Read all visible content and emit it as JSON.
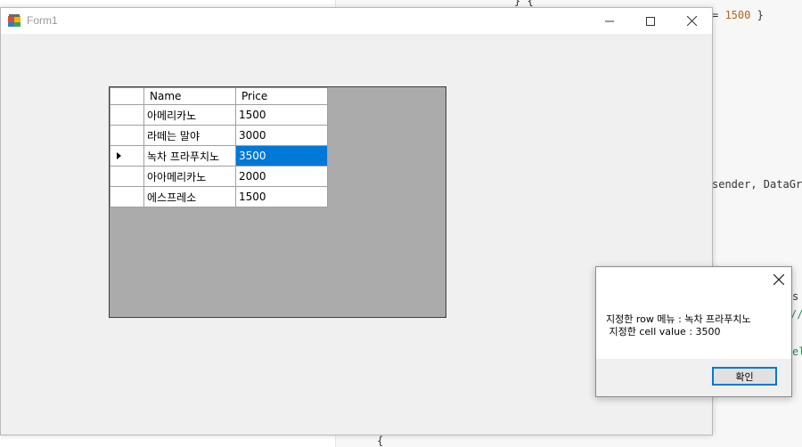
{
  "editor": {
    "lines": [
      {
        "pre": "} { ",
        "num": "",
        "post": ""
      },
      {
        "pre": "= ",
        "num": "1500",
        "post": " }"
      },
      {
        "pre": "sender, DataGri",
        "num": "",
        "post": ""
      },
      {
        "pre": "s",
        "num": "",
        "post": ""
      },
      {
        "pre": "//",
        "num": "",
        "post": ""
      },
      {
        "pre": "el",
        "num": "",
        "post": ""
      },
      {
        "pre": "{",
        "num": "",
        "post": ""
      }
    ]
  },
  "form": {
    "title": "Form1",
    "icons": {
      "app": "form-app-icon",
      "minimize": "minimize-icon",
      "maximize": "maximize-icon",
      "close": "close-icon"
    }
  },
  "grid": {
    "columns": [
      "Name",
      "Price"
    ],
    "rows": [
      {
        "name": "아메리카노",
        "price": "1500"
      },
      {
        "name": "라떼는 말야",
        "price": "3000"
      },
      {
        "name": "녹차 프라푸치노",
        "price": "3500"
      },
      {
        "name": "아아메리카노",
        "price": "2000"
      },
      {
        "name": "에스프레소",
        "price": "1500"
      }
    ],
    "current_row_index": 2,
    "selected_cell": {
      "row": 2,
      "column": "Price"
    },
    "colors": {
      "selection": "#0078d7",
      "host_background": "#ababab"
    }
  },
  "message_box": {
    "line1": "지정한 row 메뉴 : 녹차 프라푸치노",
    "line2": " 지정한 cell value : 3500",
    "ok_label": "확인",
    "close_icon": "close-icon"
  }
}
